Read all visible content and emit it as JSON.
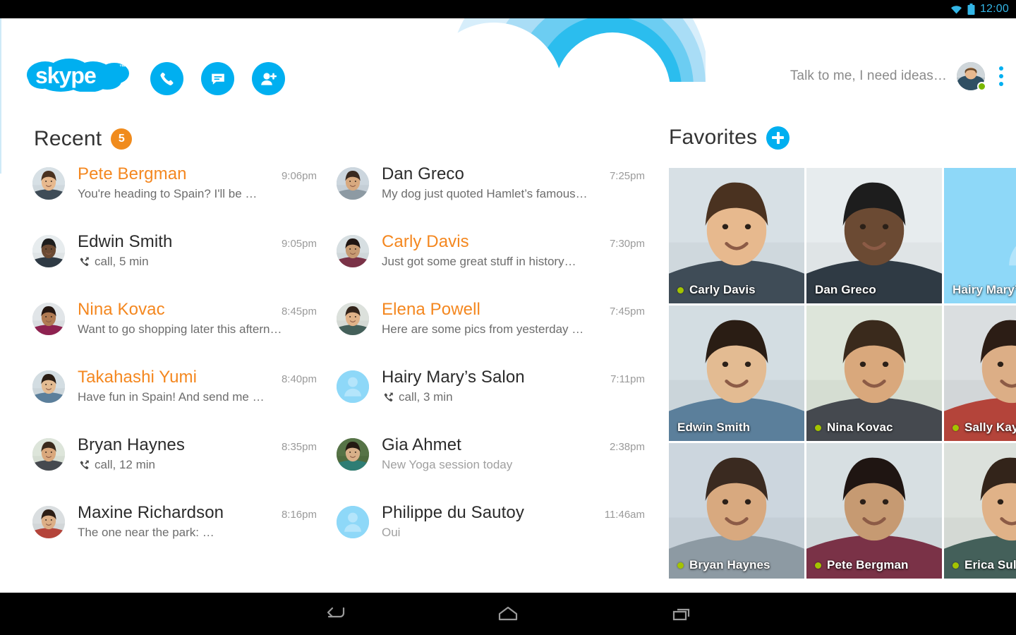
{
  "statusbar": {
    "wifi_icon": "wifi-icon",
    "battery_icon": "battery-icon",
    "time": "12:00"
  },
  "header": {
    "logo_text": "skype",
    "logo_tm": "™",
    "actions": [
      {
        "name": "call-button",
        "icon": "phone-icon"
      },
      {
        "name": "chat-button",
        "icon": "message-icon"
      },
      {
        "name": "add-contact-button",
        "icon": "add-person-icon"
      }
    ],
    "mood_message": "Talk to me, I need ideas…",
    "avatar_name": "my-avatar",
    "presence": "online",
    "overflow_icon": "kebab-menu-icon"
  },
  "recent": {
    "title": "Recent",
    "badge_count": "5",
    "items": [
      {
        "name": "Pete Bergman",
        "time": "9:06pm",
        "snippet": "You're heading to Spain? I'll be …",
        "unread": true,
        "type": "message",
        "avatar": "photo"
      },
      {
        "name": "Edwin Smith",
        "time": "9:05pm",
        "snippet": "call, 5 min",
        "unread": false,
        "type": "call",
        "avatar": "photo"
      },
      {
        "name": "Nina Kovac",
        "time": "8:45pm",
        "snippet": "Want to go shopping later this aftern…",
        "unread": true,
        "type": "message",
        "avatar": "photo"
      },
      {
        "name": "Takahashi Yumi",
        "time": "8:40pm",
        "snippet": "Have fun in Spain! And send me …",
        "unread": true,
        "type": "message",
        "avatar": "photo"
      },
      {
        "name": "Bryan Haynes",
        "time": "8:35pm",
        "snippet": "call, 12 min",
        "unread": false,
        "type": "call",
        "avatar": "photo"
      },
      {
        "name": "Maxine Richardson",
        "time": "8:16pm",
        "snippet": "The one near the park:  …",
        "unread": false,
        "type": "message",
        "avatar": "photo"
      },
      {
        "name": "Dan Greco",
        "time": "7:25pm",
        "snippet": "My dog just quoted Hamlet’s famous…",
        "unread": false,
        "type": "message",
        "avatar": "photo"
      },
      {
        "name": "Carly Davis",
        "time": "7:30pm",
        "snippet": "Just got some great stuff in history…",
        "unread": true,
        "type": "message",
        "avatar": "photo"
      },
      {
        "name": "Elena Powell",
        "time": "7:45pm",
        "snippet": "Here are some pics from yesterday …",
        "unread": true,
        "type": "message",
        "avatar": "photo"
      },
      {
        "name": "Hairy Mary’s Salon",
        "time": "7:11pm",
        "snippet": "call, 3 min",
        "unread": false,
        "type": "call",
        "avatar": "generic"
      },
      {
        "name": "Gia Ahmet",
        "time": "2:38pm",
        "snippet": "New Yoga session today",
        "unread": false,
        "type": "message",
        "avatar": "photo",
        "muted": true
      },
      {
        "name": "Philippe du Sautoy",
        "time": "11:46am",
        "snippet": "Oui",
        "unread": false,
        "type": "message",
        "avatar": "generic",
        "muted": true
      }
    ]
  },
  "favorites": {
    "title": "Favorites",
    "add_label": "add-favorite",
    "tiles": [
      {
        "name": "Carly Davis",
        "presence": "online",
        "art": "photo"
      },
      {
        "name": "Dan Greco",
        "presence": "offline",
        "art": "photo"
      },
      {
        "name": "Hairy Mary’",
        "presence": "offline",
        "art": "generic"
      },
      {
        "name": "Edwin Smith",
        "presence": "offline",
        "art": "photo"
      },
      {
        "name": "Nina Kovac",
        "presence": "online",
        "art": "photo"
      },
      {
        "name": "Sally Kay",
        "presence": "online",
        "art": "photo"
      },
      {
        "name": "Bryan Haynes",
        "presence": "online",
        "art": "photo"
      },
      {
        "name": "Pete Bergman",
        "presence": "online",
        "art": "photo"
      },
      {
        "name": "Erica Sull",
        "presence": "online",
        "art": "photo"
      }
    ]
  },
  "navbar": {
    "buttons": [
      {
        "name": "back-button",
        "icon": "back-arrow-icon"
      },
      {
        "name": "home-button",
        "icon": "home-icon"
      },
      {
        "name": "recents-button",
        "icon": "recent-apps-icon"
      }
    ]
  },
  "colors": {
    "skype_blue": "#00aff0",
    "unread_orange": "#f4871f",
    "badge_orange": "#f08b1d",
    "presence_green": "#a4c400",
    "status_accent": "#33b5e5"
  }
}
